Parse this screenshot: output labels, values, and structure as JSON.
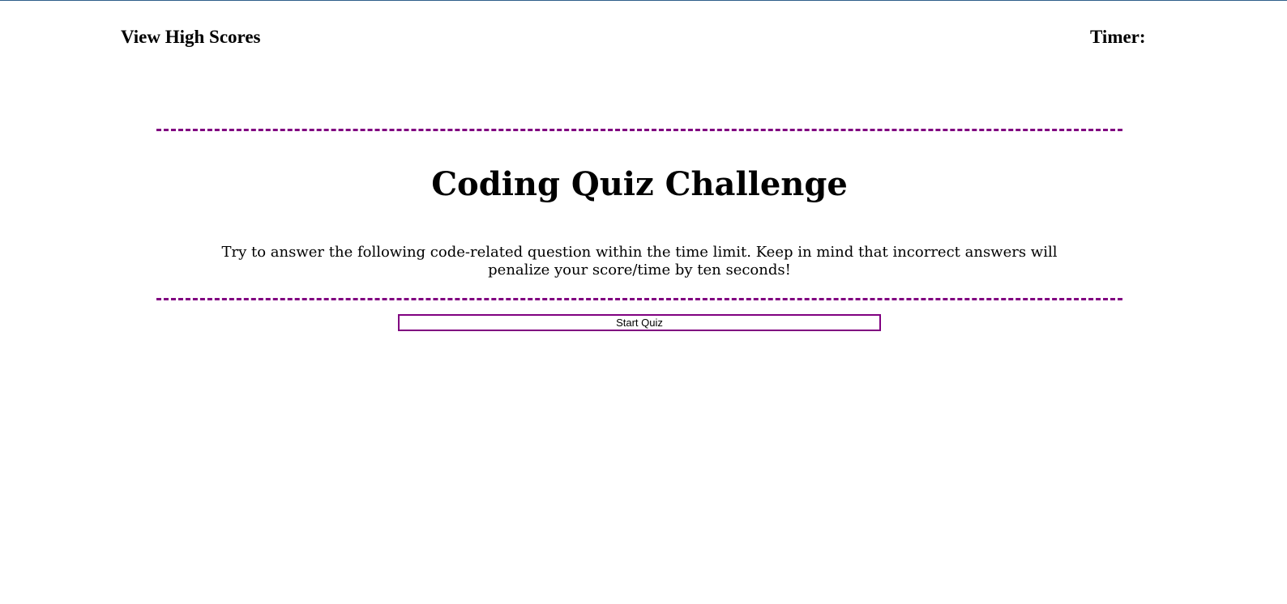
{
  "header": {
    "high_scores_label": "View High Scores",
    "timer_label": "Timer:",
    "timer_value": ""
  },
  "main": {
    "title": "Coding Quiz Challenge",
    "intro": "Try to answer the following code-related question within the time limit. Keep in mind that incorrect answers will penalize your score/time by ten seconds!",
    "start_button_label": "Start Quiz"
  },
  "colors": {
    "accent": "#800080",
    "top_rule": "#2f5f8a"
  }
}
